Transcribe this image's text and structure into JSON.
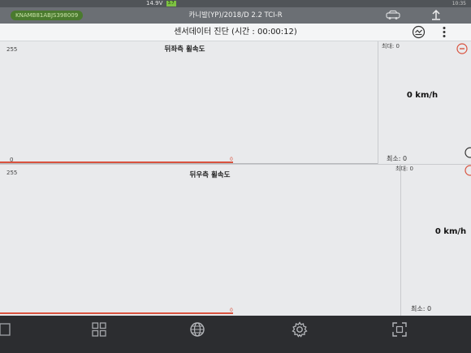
{
  "status": {
    "voltage": "14.9V",
    "battery_label": "3.7",
    "time": "10:35"
  },
  "vehicle": {
    "vin": "KNAMB81ABJS398009",
    "title": "카니발(YP)/2018/D 2.2 TCI-R"
  },
  "header": {
    "title": "센서데이터 진단 (시간 : 00:00:12)"
  },
  "panels": [
    {
      "title": "뒤좌측 휠속도",
      "y_max": "255",
      "y_min": "0",
      "baseline_value": "0",
      "max_label": "최대: 0",
      "min_label": "최소: 0",
      "speed": "0 km/h"
    },
    {
      "title": "뒤우측 휠속도",
      "y_max": "255",
      "y_min": "",
      "baseline_value": "0",
      "max_label": "최대: 0",
      "min_label": "최소: 0",
      "speed": "0 km/h"
    }
  ],
  "colors": {
    "accent": "#d9533f",
    "vin_badge": "#4a7a2e",
    "header_bar": "#6b6f74",
    "panel_bg": "#e9eaec"
  },
  "icons": {
    "car": "car-icon",
    "upload": "upload-icon",
    "graph": "graph-toggle-icon",
    "more": "more-vertical-icon",
    "collapse": "minus-circle-icon",
    "apps": "apps-grid-icon",
    "globe": "globe-icon",
    "settings": "gear-icon",
    "capture": "capture-icon"
  }
}
